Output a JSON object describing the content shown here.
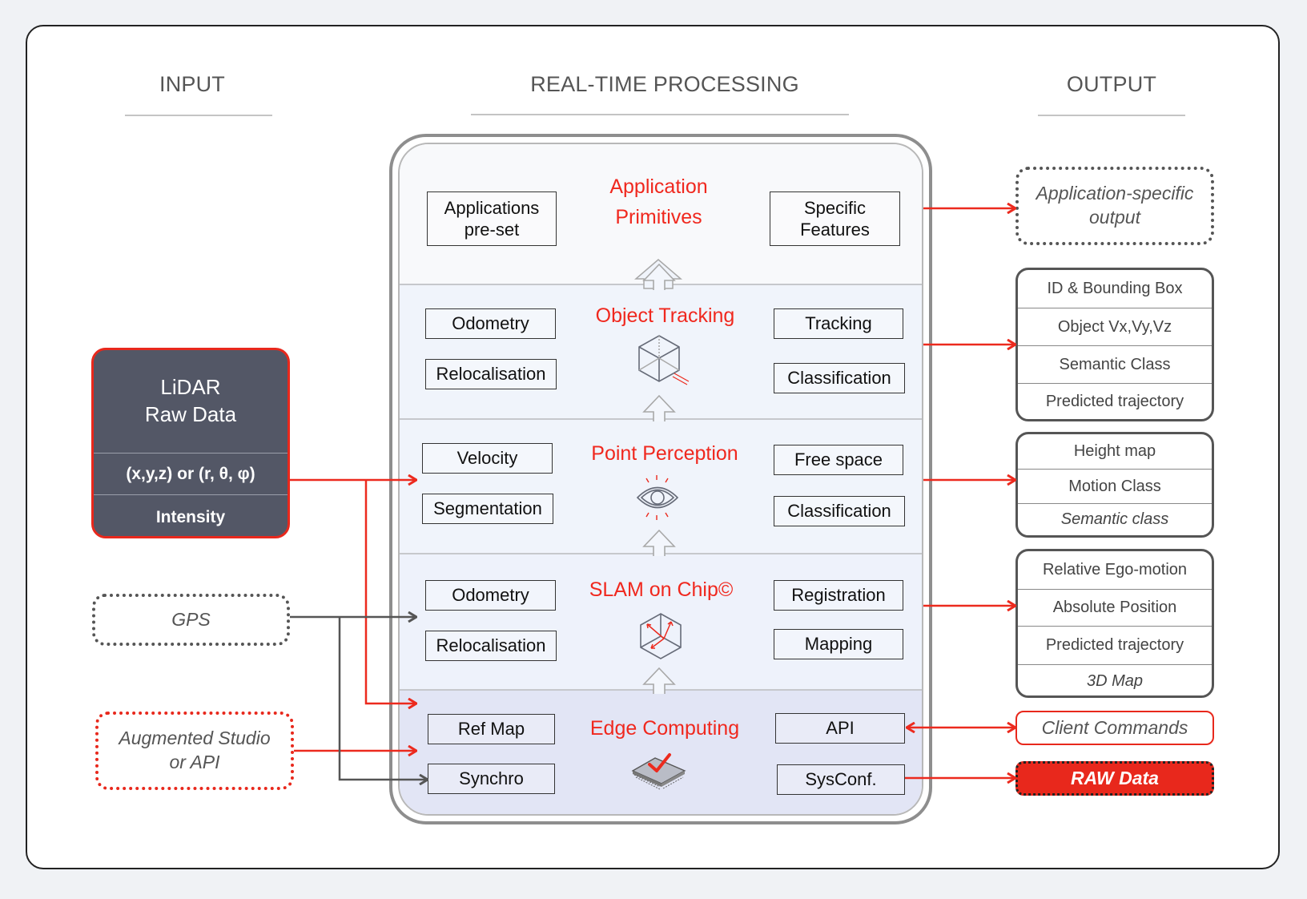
{
  "columns": {
    "input": "INPUT",
    "processing": "REAL-TIME PROCESSING",
    "output": "OUTPUT"
  },
  "inputs": {
    "lidar": {
      "title_line1": "LiDAR",
      "title_line2": "Raw Data",
      "coords": "(x,y,z) or (r, θ, φ)",
      "intensity": "Intensity"
    },
    "gps": "GPS",
    "augmented_line1": "Augmented Studio",
    "augmented_line2": "or API"
  },
  "layers": [
    {
      "title_line1": "Application",
      "title_line2": "Primitives",
      "left": [
        "Applications pre-set"
      ],
      "right": [
        "Specific Features"
      ],
      "icon": "none"
    },
    {
      "title": "Object Tracking",
      "left": [
        "Odometry",
        "Relocalisation"
      ],
      "right": [
        "Tracking",
        "Classification"
      ],
      "icon": "cube-icon"
    },
    {
      "title": "Point Perception",
      "left": [
        "Velocity",
        "Segmentation"
      ],
      "right": [
        "Free space",
        "Classification"
      ],
      "icon": "eye-icon"
    },
    {
      "title": "SLAM on Chip©",
      "left": [
        "Odometry",
        "Relocalisation"
      ],
      "right": [
        "Registration",
        "Mapping"
      ],
      "icon": "cube-axes-icon"
    },
    {
      "title": "Edge Computing",
      "left": [
        "Ref Map",
        "Synchro"
      ],
      "right": [
        "API",
        "SysConf."
      ],
      "icon": "chip-check-icon"
    }
  ],
  "outputs": {
    "app_specific_line1": "Application-specific",
    "app_specific_line2": "output",
    "tracking": [
      "ID & Bounding Box",
      "Object Vx,Vy,Vz",
      "Semantic Class",
      "Predicted trajectory"
    ],
    "perception": [
      "Height map",
      "Motion Class",
      "Semantic class"
    ],
    "slam": [
      "Relative Ego-motion",
      "Absolute Position",
      "Predicted trajectory",
      "3D Map"
    ],
    "client_commands": "Client Commands",
    "raw_data": "RAW Data"
  },
  "colors": {
    "accent_red": "#f0281e",
    "dark_box": "#535766",
    "wire_grey": "#555555"
  }
}
